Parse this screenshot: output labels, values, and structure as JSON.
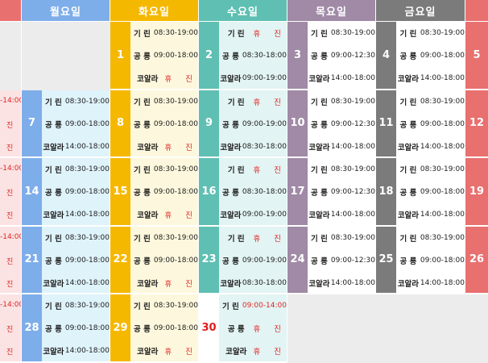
{
  "labels": {
    "giryn": "기 린",
    "gongryong": "공 룡",
    "koala": "코알라",
    "rest": "휴 진"
  },
  "colors": {
    "mon_header": "#7eaeea",
    "tue_header": "#f5b800",
    "wed_header": "#5fbfb2",
    "thu_header": "#a08aa6",
    "fri_header": "#7b7b7b",
    "sat_header": "#e8706f",
    "mon_bg": "#dff3fb",
    "tue_bg": "#fdf8dd",
    "wed_bg": "#e2f4f3",
    "thu_bg": "#ffffff",
    "fri_bg": "#ffffff",
    "sat_bg": "#fbe3e3",
    "mon_num": "#7eaeea",
    "tue_num": "#f5b800",
    "wed_num": "#5fbfb2",
    "thu_num": "#a08aa6",
    "fri_num": "#7b7b7b",
    "sat_num": "#e8706f"
  },
  "headers": [
    "월요일",
    "화요일",
    "수요일",
    "목요일",
    "금요일"
  ],
  "left_edge": {
    "time": "-14:00",
    "rest": "진"
  },
  "weeks": [
    {
      "mon": null,
      "tue": {
        "day": "1",
        "giryn": "08:30-19:00",
        "gongryong": "09:00-18:00",
        "koala": "휴 진"
      },
      "wed": {
        "day": "2",
        "giryn": "휴 진",
        "gongryong": "08:30-18:00",
        "koala": "09:00-19:00"
      },
      "thu": {
        "day": "3",
        "giryn": "08:30-19:00",
        "gongryong": "09:00-12:30",
        "koala": "14:00-18:00"
      },
      "fri": {
        "day": "4",
        "giryn": "08:30-19:00",
        "gongryong": "09:00-18:00",
        "koala": "14:00-18:00"
      },
      "sat": {
        "day": "5"
      }
    },
    {
      "mon": {
        "day": "7",
        "giryn": "08:30-19:00",
        "gongryong": "09:00-18:00",
        "koala": "14:00-18:00"
      },
      "tue": {
        "day": "8",
        "giryn": "08:30-19:00",
        "gongryong": "09:00-18:00",
        "koala": "휴 진"
      },
      "wed": {
        "day": "9",
        "giryn": "휴 진",
        "gongryong": "09:00-19:00",
        "koala": "08:30-18:00"
      },
      "thu": {
        "day": "10",
        "giryn": "08:30-19:00",
        "gongryong": "09:00-12:30",
        "koala": "14:00-18:00"
      },
      "fri": {
        "day": "11",
        "giryn": "08:30-19:00",
        "gongryong": "09:00-18:00",
        "koala": "14:00-18:00"
      },
      "sat": {
        "day": "12"
      }
    },
    {
      "mon": {
        "day": "14",
        "giryn": "08:30-19:00",
        "gongryong": "09:00-18:00",
        "koala": "14:00-18:00"
      },
      "tue": {
        "day": "15",
        "giryn": "08:30-19:00",
        "gongryong": "09:00-18:00",
        "koala": "휴 진"
      },
      "wed": {
        "day": "16",
        "giryn": "휴 진",
        "gongryong": "08:30-18:00",
        "koala": "09:00-19:00"
      },
      "thu": {
        "day": "17",
        "giryn": "08:30-19:00",
        "gongryong": "09:00-12:30",
        "koala": "14:00-18:00"
      },
      "fri": {
        "day": "18",
        "giryn": "08:30-19:00",
        "gongryong": "09:00-18:00",
        "koala": "14:00-18:00"
      },
      "sat": {
        "day": "19"
      }
    },
    {
      "mon": {
        "day": "21",
        "giryn": "08:30-19:00",
        "gongryong": "09:00-18:00",
        "koala": "14:00-18:00"
      },
      "tue": {
        "day": "22",
        "giryn": "08:30-19:00",
        "gongryong": "09:00-18:00",
        "koala": "휴 진"
      },
      "wed": {
        "day": "23",
        "giryn": "휴 진",
        "gongryong": "09:00-19:00",
        "koala": "08:30-18:00"
      },
      "thu": {
        "day": "24",
        "giryn": "08:30-19:00",
        "gongryong": "09:00-12:30",
        "koala": "14:00-18:00"
      },
      "fri": {
        "day": "25",
        "giryn": "08:30-19:00",
        "gongryong": "09:00-18:00",
        "koala": "14:00-18:00"
      },
      "sat": {
        "day": "26"
      }
    },
    {
      "mon": {
        "day": "28",
        "giryn": "08:30-19:00",
        "gongryong": "09:00-18:00",
        "koala": "14:00-18:00"
      },
      "tue": {
        "day": "29",
        "giryn": "08:30-19:00",
        "gongryong": "09:00-18:00",
        "koala": "휴 진"
      },
      "wed": {
        "day": "30",
        "day_red": true,
        "giryn": "09:00-14:00",
        "giryn_red": true,
        "gongryong": "휴 진",
        "koala": "휴 진"
      },
      "thu": null,
      "fri": null,
      "sat": null
    }
  ]
}
